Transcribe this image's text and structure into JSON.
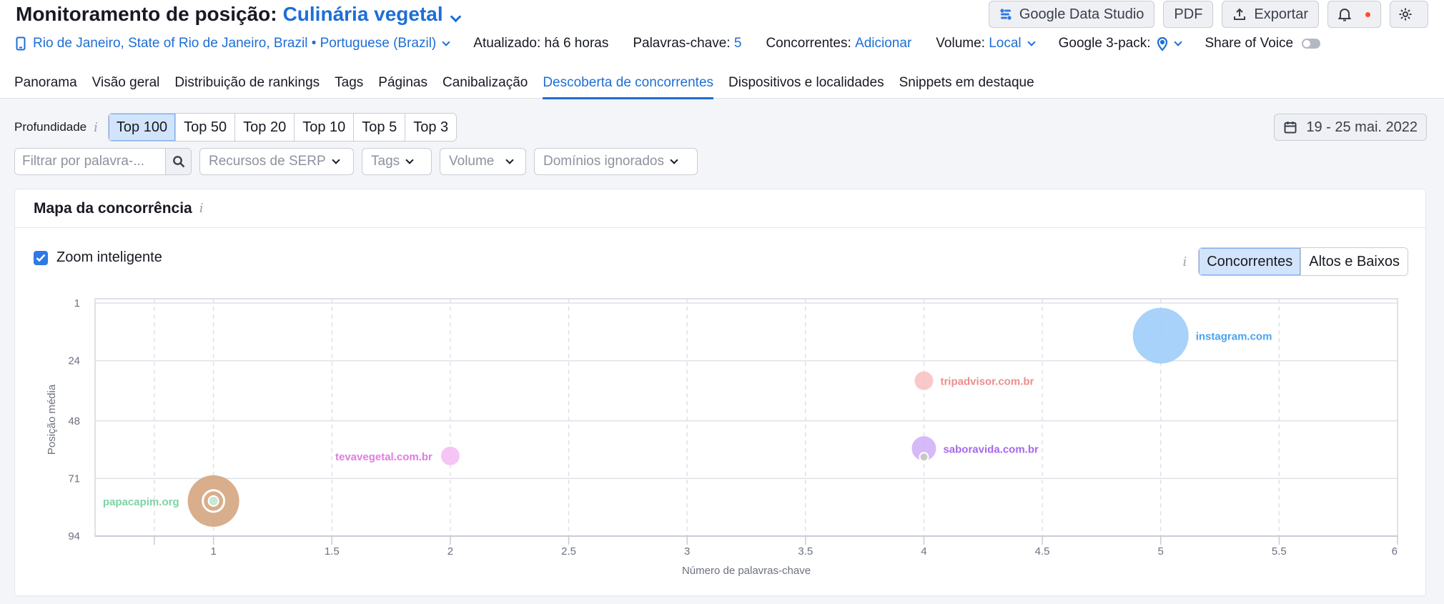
{
  "header": {
    "title": "Monitoramento de posição:",
    "project": "Culinária vegetal",
    "actions": {
      "gds": "Google Data Studio",
      "pdf": "PDF",
      "export": "Exportar"
    }
  },
  "meta": {
    "location": "Rio de Janeiro, State of Rio de Janeiro, Brazil • Portuguese (Brazil)",
    "updated": "Atualizado: há 6 horas",
    "keywords_label": "Palavras-chave:",
    "keywords_value": "5",
    "competitors_label": "Concorrentes:",
    "competitors_link": "Adicionar",
    "volume_label": "Volume:",
    "volume_value": "Local",
    "pack_label": "Google 3-pack:",
    "sov_label": "Share of Voice"
  },
  "tabs": [
    {
      "label": "Panorama"
    },
    {
      "label": "Visão geral"
    },
    {
      "label": "Distribuição de rankings"
    },
    {
      "label": "Tags"
    },
    {
      "label": "Páginas"
    },
    {
      "label": "Canibalização"
    },
    {
      "label": "Descoberta de concorrentes"
    },
    {
      "label": "Dispositivos e localidades"
    },
    {
      "label": "Snippets em destaque"
    }
  ],
  "depth": {
    "label": "Profundidade",
    "options": [
      "Top 100",
      "Top 50",
      "Top 20",
      "Top 10",
      "Top 5",
      "Top 3"
    ],
    "selected": "Top 100"
  },
  "date_range": "19 - 25 mai. 2022",
  "filters": {
    "search_placeholder": "Filtrar por palavra-...",
    "serp": "Recursos de SERP",
    "tags": "Tags",
    "volume": "Volume",
    "ignored": "Domínios ignorados"
  },
  "card": {
    "title": "Mapa da concorrência",
    "zoom_label": "Zoom inteligente",
    "zoom_checked": true,
    "view_options": [
      "Concorrentes",
      "Altos e Baixos"
    ],
    "view_selected": "Concorrentes"
  },
  "chart_data": {
    "type": "scatter",
    "xlabel": "Número de palavras-chave",
    "ylabel": "Posição média",
    "xlim": [
      0.5,
      6
    ],
    "ylim": [
      1,
      94
    ],
    "y_reversed": true,
    "x_ticks": [
      "1",
      "1.5",
      "2",
      "2.5",
      "3",
      "3.5",
      "4",
      "4.5",
      "5",
      "5.5",
      "6"
    ],
    "y_ticks": [
      "1",
      "24",
      "48",
      "71",
      "94"
    ],
    "grid": true,
    "points": [
      {
        "domain": "instagram.com",
        "x": 5,
        "y": 14,
        "color": "#9fcdf8",
        "label_color": "#4aa3f0"
      },
      {
        "domain": "tripadvisor.com.br",
        "x": 4,
        "y": 32,
        "color": "#f8c3c3",
        "label_color": "#ee8d8d"
      },
      {
        "domain": "saboravida.com.br",
        "x": 4,
        "y": 59,
        "color": "#d1b1f7",
        "label_color": "#a669ea"
      },
      {
        "domain": "tevavegetal.com.br",
        "x": 2,
        "y": 62,
        "color": "#f4bff4",
        "label_color": "#e07ce0"
      },
      {
        "domain": "papacapim.org",
        "x": 1,
        "y": 80,
        "color": "#d4a57f",
        "label_color": "#7dd3a4"
      }
    ]
  }
}
